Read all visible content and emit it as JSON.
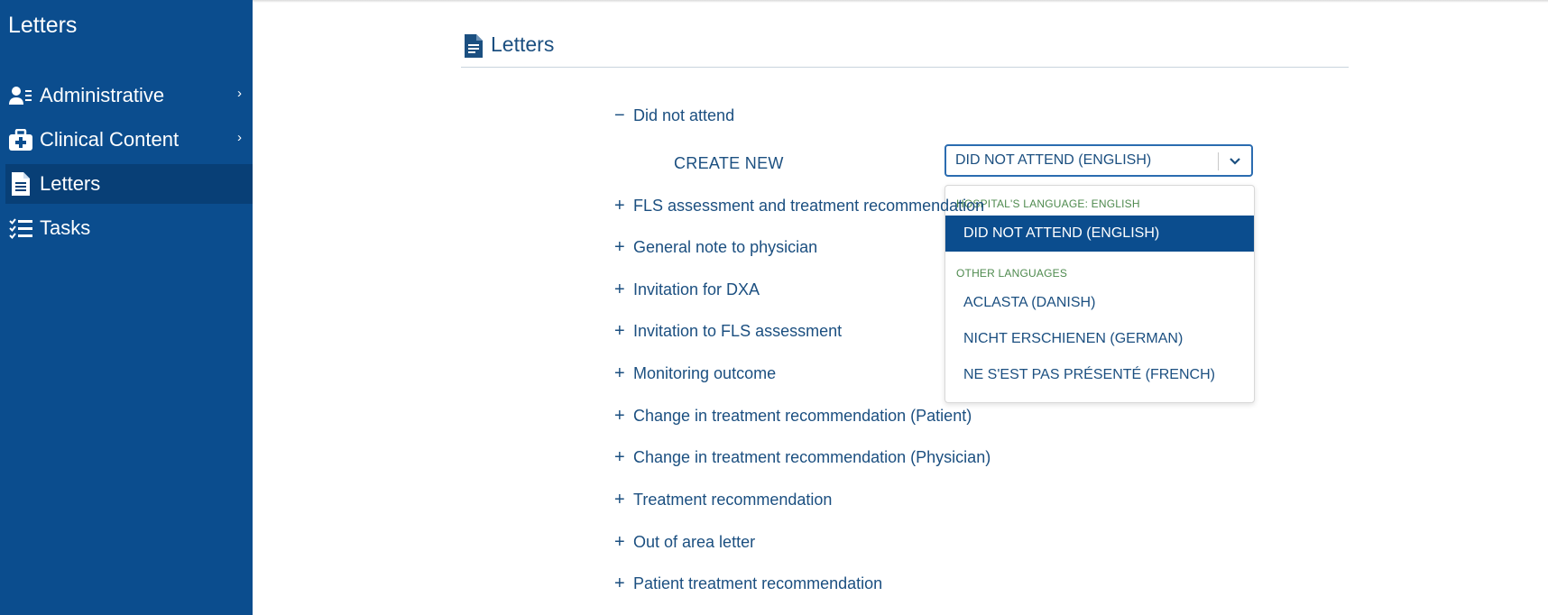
{
  "app": {
    "title": "Letters"
  },
  "sidebar": {
    "items": [
      {
        "label": "Administrative",
        "icon": "user-admin-icon",
        "has_submenu": true
      },
      {
        "label": "Clinical Content",
        "icon": "medical-kit-icon",
        "has_submenu": true
      },
      {
        "label": "Letters",
        "icon": "document-icon",
        "active": true
      },
      {
        "label": "Tasks",
        "icon": "checklist-icon"
      }
    ]
  },
  "header": {
    "title": "Letters",
    "icon": "document-icon"
  },
  "letters": {
    "expanded": {
      "label": "Did not attend",
      "toggle": "−"
    },
    "create_new_label": "CREATE NEW",
    "select": {
      "value": "DID NOT ATTEND (ENGLISH)"
    },
    "dropdown": {
      "group1_label": "HOSPITAL'S LANGUAGE: ENGLISH",
      "group1_options": [
        "DID NOT ATTEND (ENGLISH)"
      ],
      "group2_label": "OTHER LANGUAGES",
      "group2_options": [
        "ACLASTA (DANISH)",
        "NICHT ERSCHIENEN (GERMAN)",
        "NE S'EST PAS PRÉSENTÉ (FRENCH)"
      ]
    },
    "collapsed_toggle": "+",
    "collapsed": [
      "FLS assessment and treatment recommendation",
      "General note to physician",
      "Invitation for DXA",
      "Invitation to FLS assessment",
      "Monitoring outcome",
      "Change in treatment recommendation (Patient)",
      "Change in treatment recommendation (Physician)",
      "Treatment recommendation",
      "Out of area letter",
      "Patient treatment recommendation"
    ]
  },
  "colors": {
    "sidebar": "#0b4d8e",
    "sidebar_active": "#083f76",
    "text": "#1b4f80",
    "group_label": "#4e8a4e"
  }
}
